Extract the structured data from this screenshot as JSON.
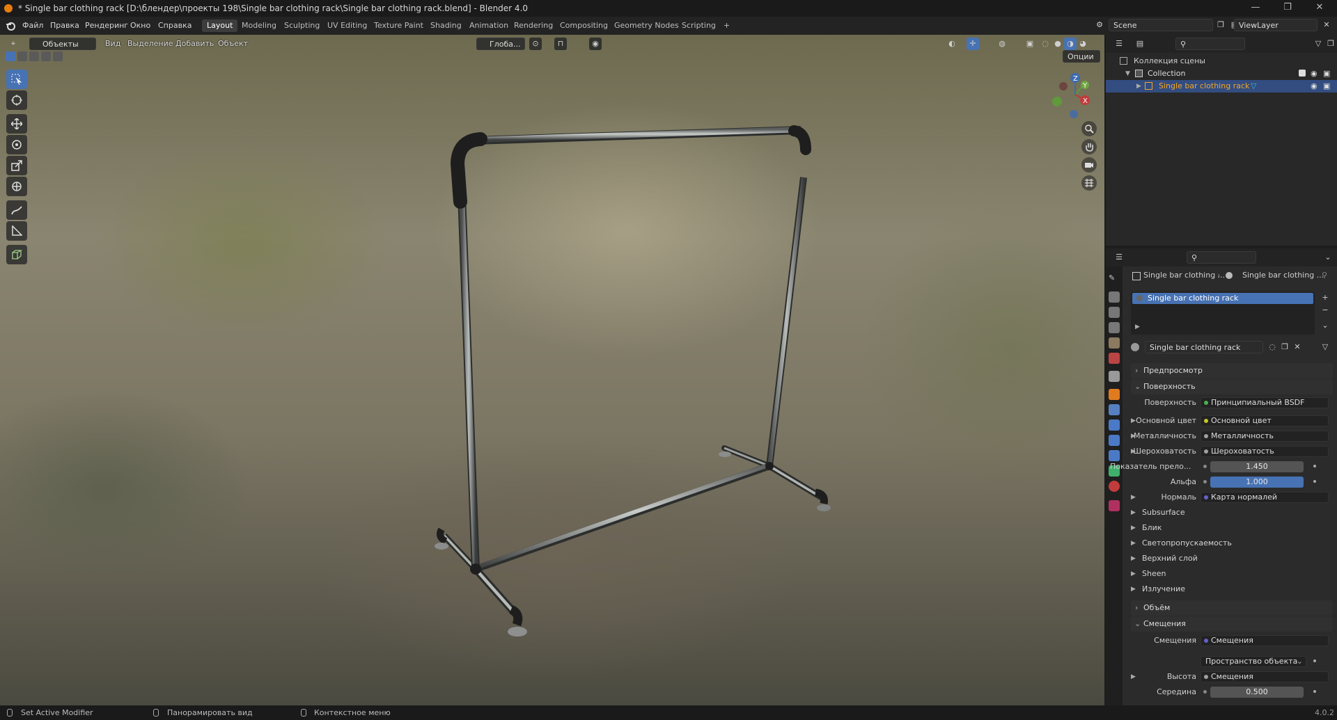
{
  "window": {
    "title": "* Single bar clothing rack [D:\\блендер\\проекты 198\\Single bar clothing rack\\Single bar clothing rack.blend] - Blender 4.0",
    "minimize": "—",
    "maximize": "❐",
    "close": "✕"
  },
  "menu": [
    "Файл",
    "Правка",
    "Рендеринг",
    "Окно",
    "Справка"
  ],
  "workspaces": [
    "Layout",
    "Modeling",
    "Sculpting",
    "UV Editing",
    "Texture Paint",
    "Shading",
    "Animation",
    "Rendering",
    "Compositing",
    "Geometry Nodes",
    "Scripting"
  ],
  "workspace_add": "+",
  "scene": {
    "name": "Scene",
    "view_layer": "ViewLayer"
  },
  "viewport": {
    "mode": "Объекты",
    "menu": [
      "Вид",
      "Выделение",
      "Добавить",
      "Объект"
    ],
    "transform_orientation": "Глоба...",
    "options": "Опции"
  },
  "gizmo": {
    "x": "X",
    "y": "Y",
    "z": "Z"
  },
  "outliner": {
    "scene_collection": "Коллекция сцены",
    "collection": "Collection",
    "object": "Single bar clothing rack"
  },
  "properties": {
    "breadcrumb_object": "Single bar clothing ...",
    "breadcrumb_material": "Single bar clothing ...",
    "slot_name": "Single bar clothing rack",
    "material_name": "Single bar clothing rack",
    "panels": {
      "preview": "Предпросмотр",
      "surface": "Поверхность",
      "volume": "Объём",
      "displacement": "Смещения"
    },
    "surface_rows": [
      {
        "label": "Поверхность",
        "value": "Принципиальный BSDF",
        "dot": "#4caf50"
      },
      {
        "label": "Основной цвет",
        "value": "Основной цвет",
        "dot": "#c7c729"
      },
      {
        "label": "Металличность",
        "value": "Металличность",
        "dot": "#a0a0a0"
      },
      {
        "label": "Шероховатость",
        "value": "Шероховатость",
        "dot": "#a0a0a0"
      }
    ],
    "ior": {
      "label": "Показатель прело...",
      "value": "1.450"
    },
    "alpha": {
      "label": "Альфа",
      "value": "1.000"
    },
    "normal": {
      "label": "Нормаль",
      "value": "Карта нормалей"
    },
    "subsections": [
      "Subsurface",
      "Блик",
      "Светопропускаемость",
      "Верхний слой",
      "Sheen",
      "Излучение"
    ],
    "displacement_rows": {
      "label": "Смещения",
      "value": "Смещения",
      "space": "Пространство объекта",
      "height_label": "Высота",
      "height_value": "Смещения",
      "mid_label": "Середина",
      "mid_value": "0.500"
    }
  },
  "statusbar": {
    "left": "Set Active Modifier",
    "middle": "Панорамировать вид",
    "right": "Контекстное меню",
    "version": "4.0.2"
  },
  "colors": {
    "accent": "#4772b3",
    "selected_text": "#f5a623"
  }
}
